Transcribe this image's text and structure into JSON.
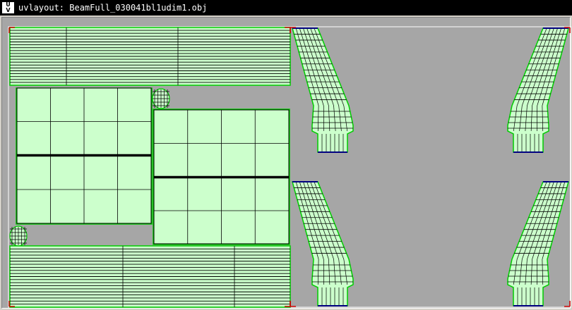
{
  "window": {
    "title": "uvlayout: BeamFull_030041bl1udim1.obj",
    "icon": "uv-app-icon",
    "icon_label_top": "U",
    "icon_label_bottom": "V"
  },
  "viewport": {
    "background_color": "#a6a6a6",
    "uv_fill_color": "#ccffcc",
    "edge_color": "#000000",
    "border_edge_color": "#00cc00",
    "seam_color": "#000080",
    "bounds_color": "#ffffff",
    "corner_marker_color": "#cc0000"
  }
}
